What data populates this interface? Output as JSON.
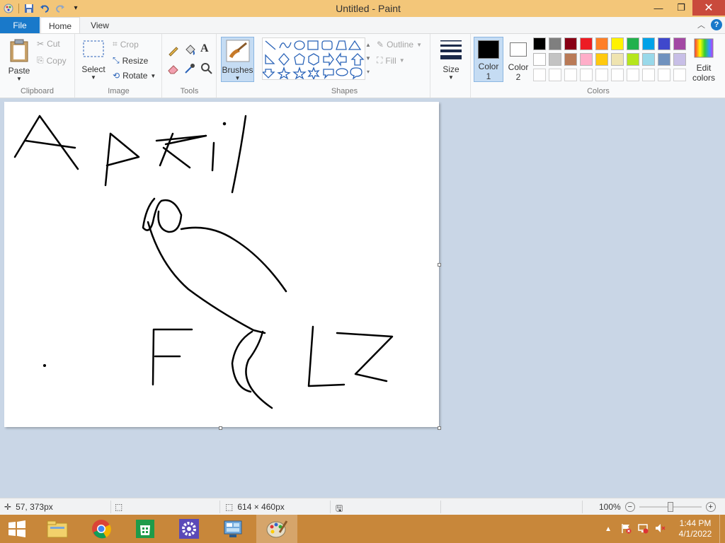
{
  "window": {
    "title": "Untitled - Paint",
    "minimize": "—",
    "restore": "❐",
    "close": "✕"
  },
  "tabs": {
    "file": "File",
    "home": "Home",
    "view": "View"
  },
  "ribbon": {
    "clipboard": {
      "label": "Clipboard",
      "paste": "Paste",
      "cut": "Cut",
      "copy": "Copy"
    },
    "image": {
      "label": "Image",
      "select": "Select",
      "crop": "Crop",
      "resize": "Resize",
      "rotate": "Rotate"
    },
    "tools": {
      "label": "Tools"
    },
    "brushes": {
      "label": "Brushes"
    },
    "shapes": {
      "label": "Shapes",
      "outline": "Outline",
      "fill": "Fill"
    },
    "size": {
      "label": "Size"
    },
    "colors": {
      "label": "Colors",
      "color1": "Color",
      "color1_num": "1",
      "color2": "Color",
      "color2_num": "2",
      "edit": "Edit",
      "edit2": "colors",
      "color1_value": "#000000",
      "color2_value": "#ffffff",
      "palette_row1": [
        "#000000",
        "#7f7f7f",
        "#880015",
        "#ed1c24",
        "#ff7f27",
        "#fff200",
        "#22b14c",
        "#00a2e8",
        "#3f48cc",
        "#a349a4"
      ],
      "palette_row2": [
        "#ffffff",
        "#c3c3c3",
        "#b97a57",
        "#ffaec9",
        "#ffc90e",
        "#efe4b0",
        "#b5e61d",
        "#99d9ea",
        "#7092be",
        "#c8bfe7"
      ],
      "palette_row3": [
        "#ffffff",
        "#ffffff",
        "#ffffff",
        "#ffffff",
        "#ffffff",
        "#ffffff",
        "#ffffff",
        "#ffffff",
        "#ffffff",
        "#ffffff"
      ]
    }
  },
  "status": {
    "cursor_pos": "57, 373px",
    "canvas_size": "614 × 460px",
    "zoom": "100%"
  },
  "taskbar": {
    "time": "1:44 PM",
    "date": "4/1/2022"
  }
}
